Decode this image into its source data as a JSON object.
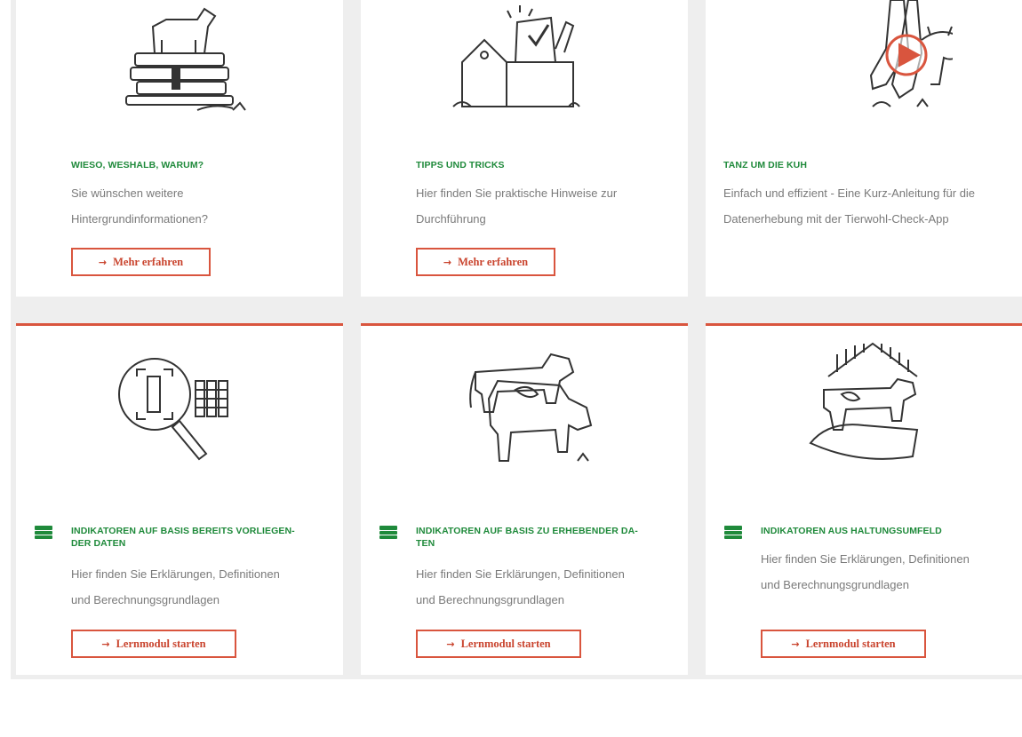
{
  "colors": {
    "accent": "#d9553e",
    "title_green": "#1f8a3b",
    "text_gray": "#7a7a7a"
  },
  "cards_top": [
    {
      "icon": "cow-on-books-icon",
      "title": "WIESO, WESHALB, WARUM?",
      "desc1": "Sie wünschen weitere",
      "desc2": "Hintergrundinformationen?",
      "button": "Mehr erfahren"
    },
    {
      "icon": "toolbox-icon",
      "title": "TIPPS UND TRICKS",
      "desc1": "Hier finden Sie praktische Hinweise zur",
      "desc2": "Durchführung",
      "button": "Mehr erfahren"
    },
    {
      "icon": "boots-cow-video-icon",
      "title": "TANZ UM DIE KUH",
      "desc1": "Einfach und effizient - Eine Kurz-Anleitung für die",
      "desc2": "Datenerhebung mit der Tierwohl-Check-App"
    }
  ],
  "cards_bottom": [
    {
      "icon": "magnifier-barcode-icon",
      "title_line1": "INDIKATOREN AUF BASIS BEREITS VORLIEGEN-",
      "title_line2": "DER DATEN",
      "desc1": "Hier finden Sie Erklärungen, Definitionen",
      "desc2": "und Berechnungsgrundlagen",
      "button": "Lernmodul starten"
    },
    {
      "icon": "two-cows-icon",
      "title_line1": "INDIKATOREN AUF BASIS ZU ERHEBENDER DA-",
      "title_line2": "TEN",
      "desc1": "Hier finden Sie Erklärungen, Definitionen",
      "desc2": "und Berechnungsgrundlagen",
      "button": "Lernmodul starten"
    },
    {
      "icon": "cow-barn-hand-icon",
      "title_line1": "INDIKATOREN AUS HALTUNGSUMFELD",
      "title_line2": "",
      "desc1": "Hier finden Sie Erklärungen, Definitionen",
      "desc2": "und Berechnungsgrundlagen",
      "button": "Lernmodul starten"
    }
  ]
}
